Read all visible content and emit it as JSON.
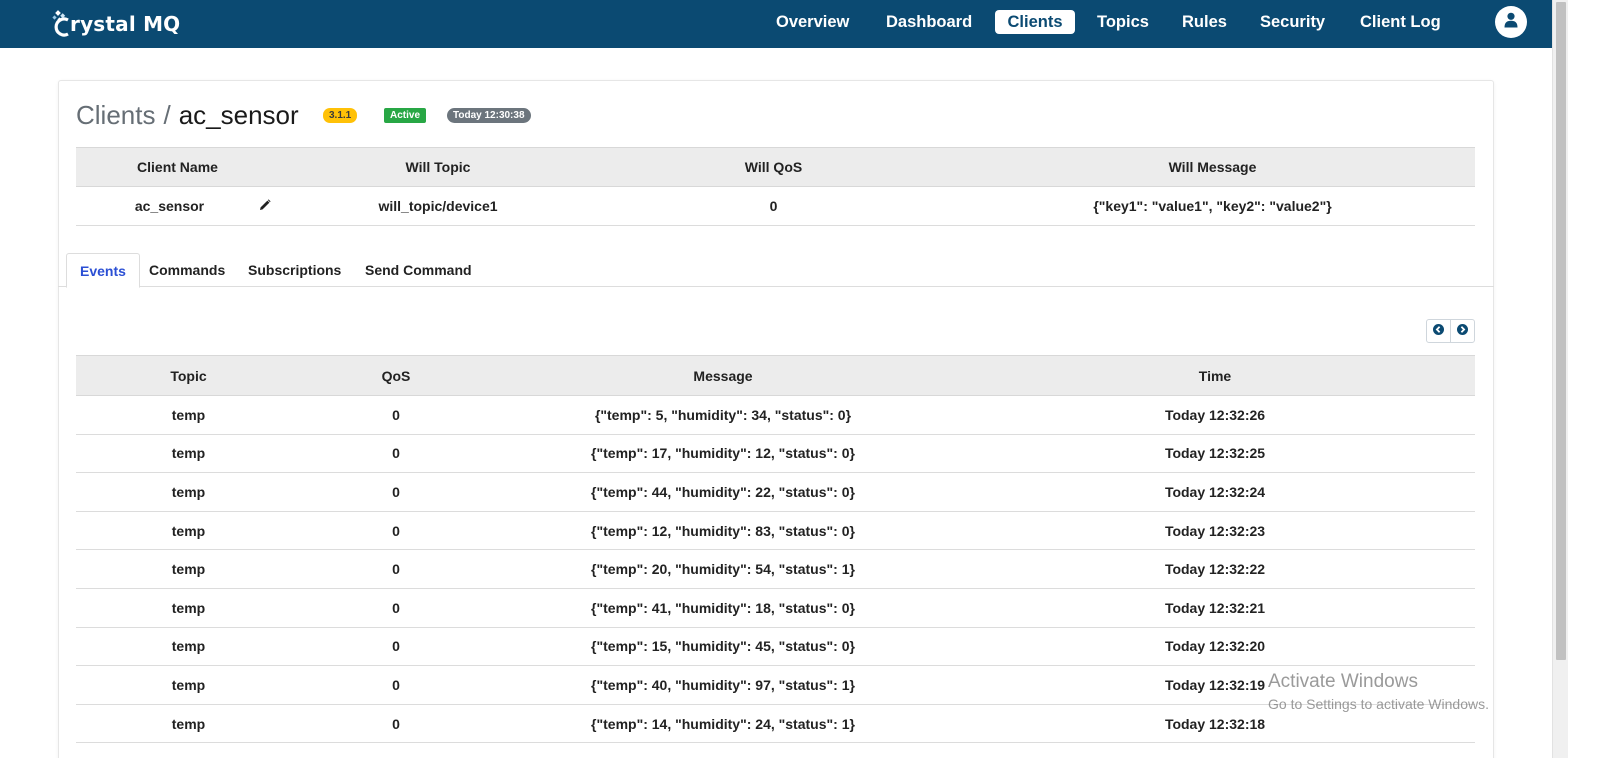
{
  "app": {
    "name": "rystal MQ"
  },
  "nav": {
    "items": [
      {
        "label": "Overview"
      },
      {
        "label": "Dashboard"
      },
      {
        "label": "Clients"
      },
      {
        "label": "Topics"
      },
      {
        "label": "Rules"
      },
      {
        "label": "Security"
      },
      {
        "label": "Client Log"
      }
    ],
    "active": "Clients"
  },
  "page": {
    "breadcrumb_parent": "Clients",
    "breadcrumb_separator": "/",
    "breadcrumb_current": "ac_sensor",
    "badges": {
      "version": "3.1.1",
      "status": "Active",
      "time": "Today 12:30:38"
    }
  },
  "client_info": {
    "headers": [
      "Client Name",
      "Will Topic",
      "Will QoS",
      "Will Message"
    ],
    "row": {
      "client_name": "ac_sensor",
      "will_topic": "will_topic/device1",
      "will_qos": "0",
      "will_message": "{\"key1\": \"value1\", \"key2\": \"value2\"}"
    }
  },
  "tabs": [
    {
      "label": "Events"
    },
    {
      "label": "Commands"
    },
    {
      "label": "Subscriptions"
    },
    {
      "label": "Send Command"
    }
  ],
  "active_tab": "Events",
  "events": {
    "headers": [
      "Topic",
      "QoS",
      "Message",
      "Time"
    ],
    "rows": [
      {
        "topic": "temp",
        "qos": "0",
        "message": "{\"temp\": 5, \"humidity\": 34, \"status\": 0}",
        "time": "Today 12:32:26"
      },
      {
        "topic": "temp",
        "qos": "0",
        "message": "{\"temp\": 17, \"humidity\": 12, \"status\": 0}",
        "time": "Today 12:32:25"
      },
      {
        "topic": "temp",
        "qos": "0",
        "message": "{\"temp\": 44, \"humidity\": 22, \"status\": 0}",
        "time": "Today 12:32:24"
      },
      {
        "topic": "temp",
        "qos": "0",
        "message": "{\"temp\": 12, \"humidity\": 83, \"status\": 0}",
        "time": "Today 12:32:23"
      },
      {
        "topic": "temp",
        "qos": "0",
        "message": "{\"temp\": 20, \"humidity\": 54, \"status\": 1}",
        "time": "Today 12:32:22"
      },
      {
        "topic": "temp",
        "qos": "0",
        "message": "{\"temp\": 41, \"humidity\": 18, \"status\": 0}",
        "time": "Today 12:32:21"
      },
      {
        "topic": "temp",
        "qos": "0",
        "message": "{\"temp\": 15, \"humidity\": 45, \"status\": 0}",
        "time": "Today 12:32:20"
      },
      {
        "topic": "temp",
        "qos": "0",
        "message": "{\"temp\": 40, \"humidity\": 97, \"status\": 1}",
        "time": "Today 12:32:19"
      },
      {
        "topic": "temp",
        "qos": "0",
        "message": "{\"temp\": 14, \"humidity\": 24, \"status\": 1}",
        "time": "Today 12:32:18"
      }
    ]
  },
  "watermark": {
    "title": "Activate Windows",
    "subtitle": "Go to Settings to activate Windows."
  },
  "icons": {
    "logo": "crystal-logo-icon",
    "avatar": "user-icon",
    "edit": "pencil-icon",
    "pager_prev": "chevron-left-icon",
    "pager_next": "chevron-right-icon"
  },
  "colors": {
    "navbar": "#0b4a72",
    "active_tab": "#2b4fd4",
    "badge_version": "#ffc107",
    "badge_status": "#28a745",
    "badge_time": "#6c757d",
    "table_header": "#ececec"
  }
}
